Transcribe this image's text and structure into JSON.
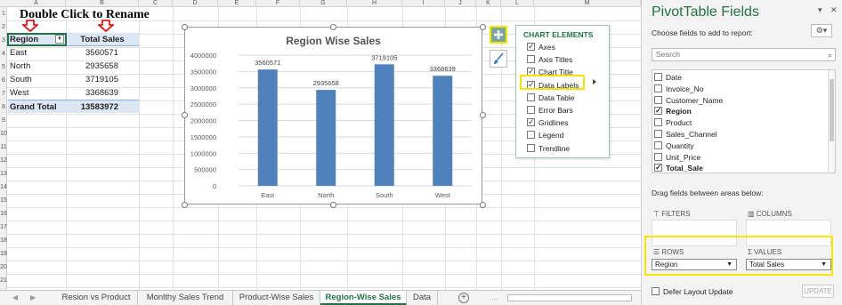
{
  "sheet": {
    "columns": [
      "A",
      "B",
      "C",
      "D",
      "E",
      "F",
      "G",
      "H",
      "I",
      "J",
      "K",
      "L",
      "M"
    ],
    "rows": [
      "1",
      "2",
      "3",
      "4",
      "5",
      "6",
      "7",
      "8",
      "9",
      "10",
      "11",
      "12",
      "13",
      "14",
      "15",
      "16",
      "17",
      "18",
      "19",
      "20",
      "21"
    ],
    "banner": "Double Click to Rename"
  },
  "pivot": {
    "header_region": "Region",
    "header_total": "Total Sales",
    "rows": [
      {
        "label": "East",
        "value": "3560571"
      },
      {
        "label": "North",
        "value": "2935658"
      },
      {
        "label": "South",
        "value": "3719105"
      },
      {
        "label": "West",
        "value": "3368639"
      }
    ],
    "grand_total_label": "Grand Total",
    "grand_total_value": "13583972"
  },
  "chart_data": {
    "type": "bar",
    "title": "Region Wise Sales",
    "categories": [
      "East",
      "North",
      "South",
      "West"
    ],
    "values": [
      3560571,
      2935658,
      3719105,
      3368639
    ],
    "data_labels": [
      "3560571",
      "2935658",
      "3719105",
      "3368639"
    ],
    "y_ticks": [
      "4000000",
      "3500000",
      "3000000",
      "2500000",
      "2000000",
      "1500000",
      "1000000",
      "500000",
      "0"
    ],
    "ylim": [
      0,
      4000000
    ],
    "grid": true,
    "legend": false,
    "bar_color": "#4f81bd"
  },
  "chart_elements": {
    "title": "CHART ELEMENTS",
    "items": [
      {
        "label": "Axes",
        "checked": true
      },
      {
        "label": "Axis Titles",
        "checked": false
      },
      {
        "label": "Chart Title",
        "checked": true
      },
      {
        "label": "Data Labels",
        "checked": true
      },
      {
        "label": "Data Table",
        "checked": false
      },
      {
        "label": "Error Bars",
        "checked": false
      },
      {
        "label": "Gridlines",
        "checked": true
      },
      {
        "label": "Legend",
        "checked": false
      },
      {
        "label": "Trendline",
        "checked": false
      }
    ]
  },
  "tabs": {
    "items": [
      "Resion vs Product",
      "Monlthy Sales Trend",
      "Product-Wise Sales",
      "Region-Wise Sales",
      "Data"
    ],
    "active": "Region-Wise Sales",
    "add": "+",
    "nav_prev": "◀",
    "nav_next": "▶",
    "more": "…"
  },
  "pane": {
    "title": "PivotTable Fields",
    "subtitle": "Choose fields to add to report:",
    "search_placeholder": "Search",
    "fields": [
      {
        "label": "Date",
        "checked": false
      },
      {
        "label": "Invoice_No",
        "checked": false
      },
      {
        "label": "Customer_Name",
        "checked": false
      },
      {
        "label": "Region",
        "checked": true
      },
      {
        "label": "Product",
        "checked": false
      },
      {
        "label": "Sales_Channel",
        "checked": false
      },
      {
        "label": "Quantity",
        "checked": false
      },
      {
        "label": "Unit_Price",
        "checked": false
      },
      {
        "label": "Total_Sale",
        "checked": true
      }
    ],
    "drag_text": "Drag fields between areas below:",
    "filters_label": "FILTERS",
    "columns_label": "COLUMNS",
    "rows_label": "ROWS",
    "values_label": "VALUES",
    "rows_value": "Region",
    "values_value": "Total Sales",
    "defer_label": "Defer Layout Update",
    "update_label": "UPDATE"
  },
  "colors": {
    "accent": "#217346",
    "highlight": "#f5e600",
    "pivot_header": "#dde7f3"
  }
}
